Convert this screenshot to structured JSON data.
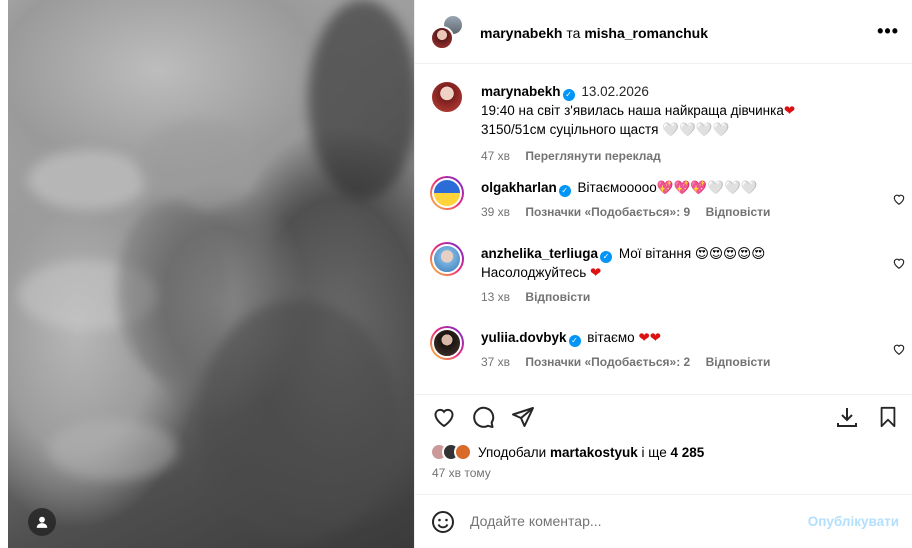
{
  "post": {
    "author": "marynabekh",
    "connector": "та",
    "coauthor": "misha_romanchuk",
    "more_label": "•••"
  },
  "caption": {
    "username": "marynabekh",
    "date": "13.02.2026",
    "line1": "19:40 на світ з'явилась наша найкраща дівчинка",
    "line1_emoji": "❤",
    "line2": "3150/51см суцільного щастя ",
    "line2_emoji": "🤍🤍🤍🤍",
    "time": "47 хв",
    "translate_label": "Переглянути переклад"
  },
  "comments": [
    {
      "username": "olgakharlan",
      "text": "Вітаємооооо",
      "emoji": "💖💖💖🤍🤍🤍",
      "time": "39 хв",
      "likes": "Позначки «Подобається»: 9",
      "reply": "Відповісти"
    },
    {
      "username": "anzhelika_terliuga",
      "text": "Мої вітання ",
      "emoji": "😍😍😍😍😍",
      "text2": "Насолоджуйтесь ",
      "emoji2": "❤",
      "time": "13 хв",
      "reply": "Відповісти"
    },
    {
      "username": "yuliia.dovbyk",
      "text": "вітаємо ",
      "emoji": "❤❤",
      "time": "37 хв",
      "likes": "Позначки «Подобається»: 2",
      "reply": "Відповісти"
    }
  ],
  "likes": {
    "prefix": "Уподобали ",
    "user": "martakostyuk",
    "middle": " і ще ",
    "count": "4 285"
  },
  "posted_ago": "47 хв тому",
  "composer": {
    "placeholder": "Додайте коментар...",
    "publish_label": "Опублікувати"
  },
  "colors": {
    "accent": "#0095f6",
    "muted": "#737373",
    "publish_disabled": "#b2dffc",
    "heart_red": "#dd1111"
  },
  "icons": [
    "user-tag-icon",
    "more-icon",
    "heart-icon",
    "comment-icon",
    "share-icon",
    "save-icon",
    "emoji-icon",
    "verified-icon"
  ]
}
